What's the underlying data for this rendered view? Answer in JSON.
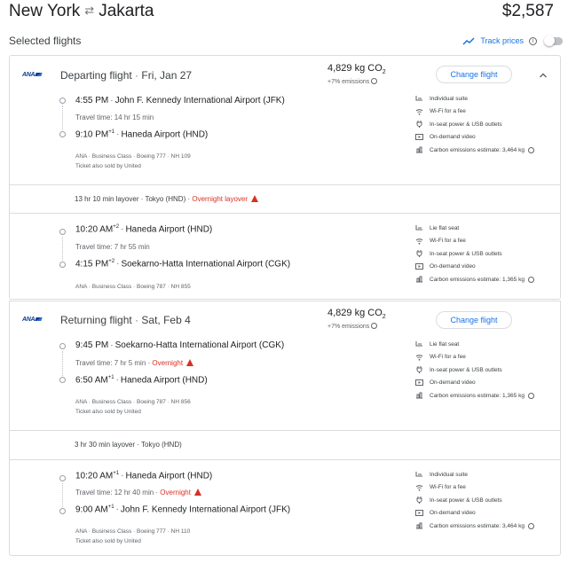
{
  "header": {
    "origin": "New York",
    "destination": "Jakarta",
    "price": "$2,587"
  },
  "selected_flights_label": "Selected flights",
  "track_prices_label": "Track prices",
  "departing": {
    "title": "Departing flight",
    "date": "Fri, Jan 27",
    "co2": "4,829 kg CO",
    "co2_sub": "2",
    "emissions": "+7% emissions",
    "change_label": "Change flight",
    "leg1": {
      "dep_time": "4:55 PM",
      "dep_airport": "John F. Kennedy International Airport (JFK)",
      "travel_time": "Travel time: 14 hr 15 min",
      "arr_time": "9:10 PM",
      "arr_offset": "+1",
      "arr_airport": "Haneda Airport (HND)",
      "details": "ANA · Business Class · Boeing 777 · NH 109",
      "sold_by": "Ticket also sold by United",
      "amenities": [
        "Individual suite",
        "Wi-Fi for a fee",
        "In-seat power & USB outlets",
        "On-demand video",
        "Carbon emissions estimate: 3,464 kg"
      ]
    },
    "layover": "13 hr 10 min layover · Tokyo (HND) · ",
    "layover_overnight": "Overnight layover",
    "leg2": {
      "dep_time": "10:20 AM",
      "dep_offset": "+2",
      "dep_airport": "Haneda Airport (HND)",
      "travel_time": "Travel time: 7 hr 55 min",
      "arr_time": "4:15 PM",
      "arr_offset": "+2",
      "arr_airport": "Soekarno-Hatta International Airport (CGK)",
      "details": "ANA · Business Class · Boeing 787 · NH 855",
      "amenities": [
        "Lie flat seat",
        "Wi-Fi for a fee",
        "In-seat power & USB outlets",
        "On-demand video",
        "Carbon emissions estimate: 1,365 kg"
      ]
    }
  },
  "returning": {
    "title": "Returning flight",
    "date": "Sat, Feb 4",
    "co2": "4,829 kg CO",
    "co2_sub": "2",
    "emissions": "+7% emissions",
    "change_label": "Change flight",
    "leg1": {
      "dep_time": "9:45 PM",
      "dep_airport": "Soekarno-Hatta International Airport (CGK)",
      "travel_time": "Travel time: 7 hr 5 min · ",
      "travel_overnight": "Overnight",
      "arr_time": "6:50 AM",
      "arr_offset": "+1",
      "arr_airport": "Haneda Airport (HND)",
      "details": "ANA · Business Class · Boeing 787 · NH 856",
      "sold_by": "Ticket also sold by United",
      "amenities": [
        "Lie flat seat",
        "Wi-Fi for a fee",
        "In-seat power & USB outlets",
        "On-demand video",
        "Carbon emissions estimate: 1,365 kg"
      ]
    },
    "layover": "3 hr 30 min layover · Tokyo (HND)",
    "leg2": {
      "dep_time": "10:20 AM",
      "dep_offset": "+1",
      "dep_airport": "Haneda Airport (HND)",
      "travel_time": "Travel time: 12 hr 40 min · ",
      "travel_overnight": "Overnight",
      "arr_time": "9:00 AM",
      "arr_offset": "+1",
      "arr_airport": "John F. Kennedy International Airport (JFK)",
      "details": "ANA · Business Class · Boeing 777 · NH 110",
      "sold_by": "Ticket also sold by United",
      "amenities": [
        "Individual suite",
        "Wi-Fi for a fee",
        "In-seat power & USB outlets",
        "On-demand video",
        "Carbon emissions estimate: 3,464 kg"
      ]
    }
  },
  "airline_logo_text": "ANA",
  "colors": {
    "accent": "#1a73e8",
    "warning": "#d93025",
    "border": "#dadce0"
  },
  "icons": [
    "swap-arrows-icon",
    "trend-line-icon",
    "info-icon",
    "chevron-up-icon",
    "warning-icon",
    "seat-icon",
    "wifi-icon",
    "power-plug-icon",
    "video-icon",
    "emissions-icon"
  ]
}
